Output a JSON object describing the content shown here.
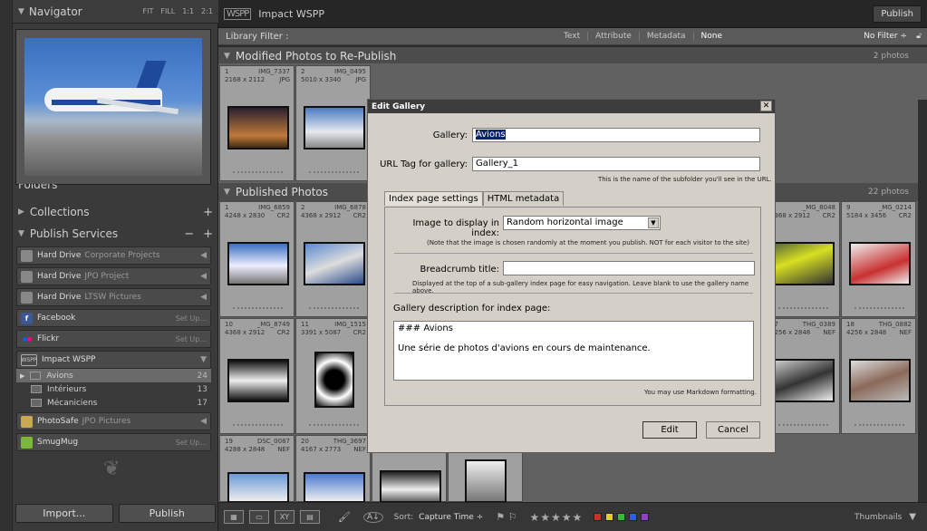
{
  "navigator": {
    "title": "Navigator",
    "zoom_options": [
      "FIT",
      "FILL",
      "1:1",
      "2:1"
    ]
  },
  "left_sections": {
    "folders": "Folders",
    "collections": "Collections",
    "publish_services": "Publish Services"
  },
  "publish_services": [
    {
      "name": "Hard Drive",
      "sub": "Corporate Projects",
      "action": "◀"
    },
    {
      "name": "Hard Drive",
      "sub": "JPO Project",
      "action": "◀"
    },
    {
      "name": "Hard Drive",
      "sub": "LTSW Pictures",
      "action": "◀"
    },
    {
      "name": "Facebook",
      "sub": "",
      "action": "Set Up..."
    },
    {
      "name": "Flickr",
      "sub": "",
      "action": "Set Up..."
    },
    {
      "name": "Impact WSPP",
      "sub": "",
      "action": "▼"
    }
  ],
  "wspp_collections": [
    {
      "name": "Avions",
      "count": "24"
    },
    {
      "name": "Intérieurs",
      "count": "13"
    },
    {
      "name": "Mécaniciens",
      "count": "17"
    }
  ],
  "publish_services_more": [
    {
      "name": "PhotoSafe",
      "sub": "JPO Pictures",
      "action": "◀"
    },
    {
      "name": "SmugMug",
      "sub": "",
      "action": "Set Up..."
    }
  ],
  "left_buttons": {
    "import": "Import...",
    "publish": "Publish"
  },
  "topbar": {
    "logo": "WSPP",
    "title": "Impact WSPP",
    "publish": "Publish"
  },
  "filter": {
    "label": "Library Filter :",
    "options": [
      "Text",
      "Attribute",
      "Metadata",
      "None"
    ],
    "no_filter": "No Filter ÷"
  },
  "groups": {
    "modified": {
      "title": "Modified Photos to Re-Publish",
      "count": "2 photos"
    },
    "published": {
      "title": "Published Photos",
      "count": "22 photos"
    }
  },
  "grid": {
    "modified": [
      {
        "num": "1",
        "file": "IMG_7337",
        "dims": "2168 x 2112",
        "ext": "JPG"
      },
      {
        "num": "2",
        "file": "IMG_0495",
        "dims": "5010 x 3340",
        "ext": "JPG"
      }
    ],
    "published_row1": [
      {
        "num": "1",
        "file": "IMG_6859",
        "dims": "4248 x 2830",
        "ext": "CR2"
      },
      {
        "num": "2",
        "file": "IMG_6878",
        "dims": "4368 x 2912",
        "ext": "CR2"
      },
      {
        "num": "8",
        "file": "_MG_8048",
        "dims": "4368 x 2912",
        "ext": "CR2"
      },
      {
        "num": "9",
        "file": "_MG_0214",
        "dims": "5184 x 3456",
        "ext": "CR2"
      }
    ],
    "published_row2": [
      {
        "num": "10",
        "file": "_MG_8749",
        "dims": "4368 x 2912",
        "ext": "CR2"
      },
      {
        "num": "11",
        "file": "IMG_1515",
        "dims": "3391 x 5087",
        "ext": "CR2"
      },
      {
        "num": "17",
        "file": "THG_0389",
        "dims": "4256 x 2848",
        "ext": "NEF"
      },
      {
        "num": "18",
        "file": "THG_0882",
        "dims": "4256 x 2848",
        "ext": "NEF"
      }
    ],
    "published_row3": [
      {
        "num": "19",
        "file": "DSC_0087",
        "dims": "4288 x 2848",
        "ext": "NEF"
      },
      {
        "num": "20",
        "file": "THG_3697",
        "dims": "4167 x 2773",
        "ext": "NEF"
      }
    ]
  },
  "dialog": {
    "title": "Edit Gallery",
    "gallery_label": "Gallery:",
    "gallery_value": "Avions",
    "url_label": "URL Tag for gallery:",
    "url_value": "Gallery_1",
    "url_hint": "This is the name of the subfolder you'll see in the URL.",
    "tabs": [
      "Index page settings",
      "HTML metadata"
    ],
    "image_label": "Image to display in index:",
    "image_value": "Random horizontal image",
    "image_hint": "(Note that the image is chosen randomly at the moment you publish. NOT for each visitor to the site)",
    "breadcrumb_label": "Breadcrumb title:",
    "breadcrumb_value": "",
    "breadcrumb_hint": "Displayed at the top of a sub-gallery index page for easy navigation. Leave blank to use the gallery name above.",
    "desc_label": "Gallery description for index page:",
    "desc_value": "### Avions\n\nUne série de photos d'avions en cours de maintenance.",
    "markdown_hint": "You may use Markdown formatting.",
    "edit": "Edit",
    "cancel": "Cancel"
  },
  "bottom": {
    "sort_label": "Sort:",
    "sort_value": "Capture Time ÷",
    "thumbnails": "Thumbnails",
    "colors": [
      "#d32a2a",
      "#e0d020",
      "#38b838",
      "#3060d8",
      "#9040c8"
    ]
  }
}
